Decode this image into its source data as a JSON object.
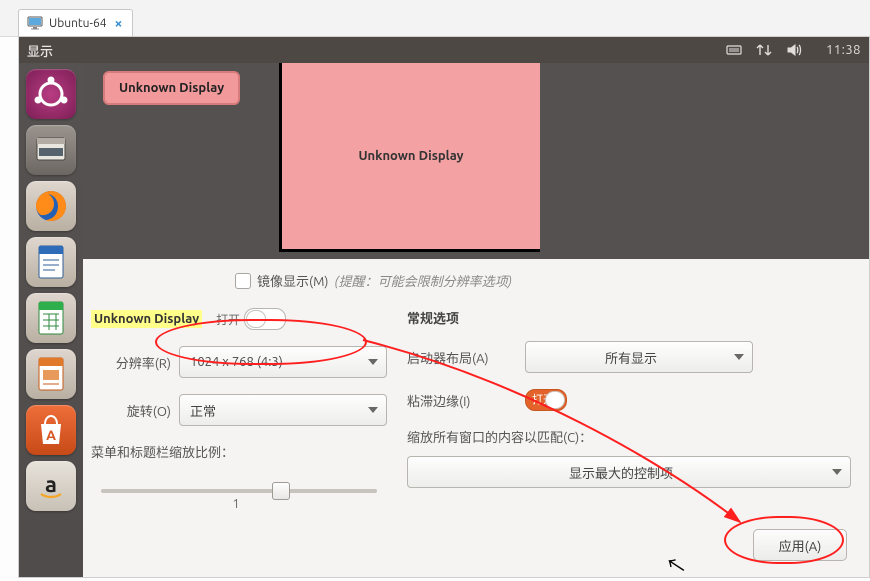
{
  "host": {
    "tab_label": "Ubuntu-64"
  },
  "menubar": {
    "title": "显示",
    "clock": "11:38"
  },
  "preview": {
    "selected_display_label": "Unknown Display",
    "big_display_label": "Unknown Display"
  },
  "mirror": {
    "label": "镜像显示(M)",
    "hint": "(提醒：可能会限制分辨率选项)"
  },
  "left": {
    "current_display": "Unknown Display",
    "open_label": "打开",
    "resolution_label": "分辨率(R)",
    "resolution_value": "1024 x 768 (4:3)",
    "rotation_label": "旋转(O)",
    "rotation_value": "正常",
    "scale_label": "菜单和标题栏缩放比例：",
    "scale_value": "1"
  },
  "right": {
    "section_head": "常规选项",
    "launcher_label": "启动器布局(A)",
    "launcher_value": "所有显示",
    "sticky_label": "粘滞边缘(I)",
    "sticky_switch_text": "打开",
    "scale_match_label": "缩放所有窗口的内容以匹配(C)：",
    "scale_match_value": "显示最大的控制项"
  },
  "apply_label": "应用(A)"
}
